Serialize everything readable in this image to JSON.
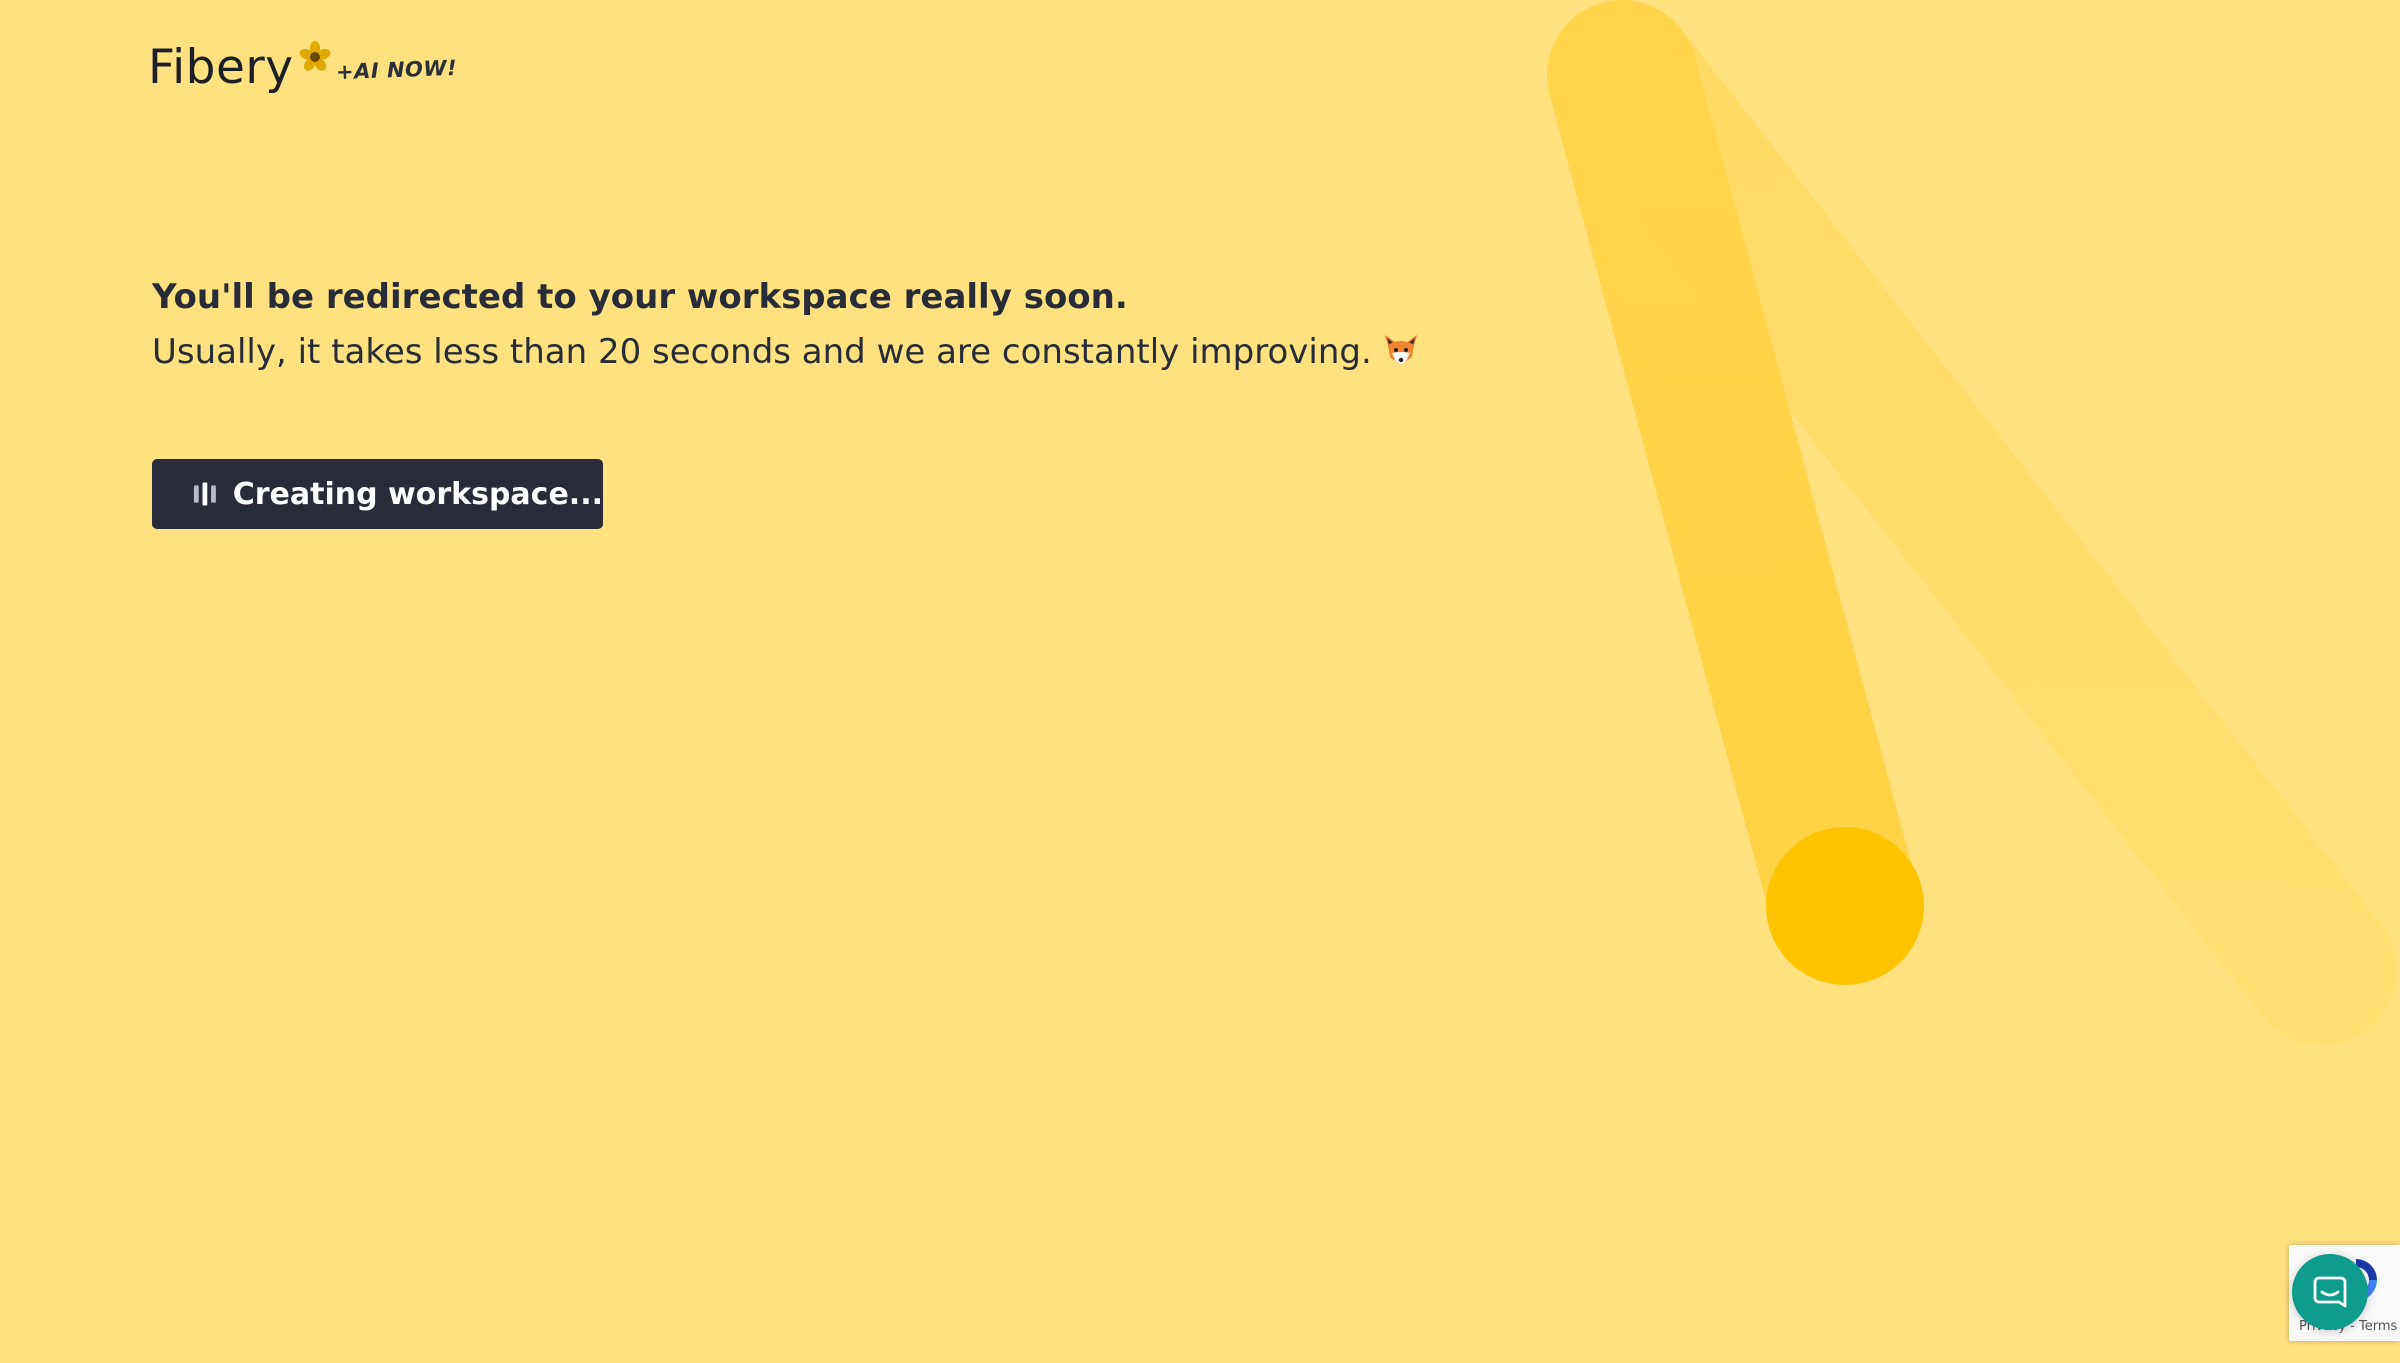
{
  "brand": {
    "name": "Fibery",
    "tagline": "+AI NOW!"
  },
  "message": {
    "headline": "You'll be redirected to your workspace really soon.",
    "subline": "Usually, it takes less than 20 seconds and we are constantly improving."
  },
  "action": {
    "label": "Creating workspace..."
  },
  "recaptcha": {
    "links": "Privacy - Terms"
  },
  "colors": {
    "background": "#ffe17f",
    "accent": "#ffc300",
    "button": "#272c38",
    "chat": "#0e9c8f"
  },
  "icons": {
    "logo": "flower-icon",
    "emoji": "fox-icon",
    "loading": "loading-bars-icon",
    "chat": "chat-bubble-icon"
  }
}
